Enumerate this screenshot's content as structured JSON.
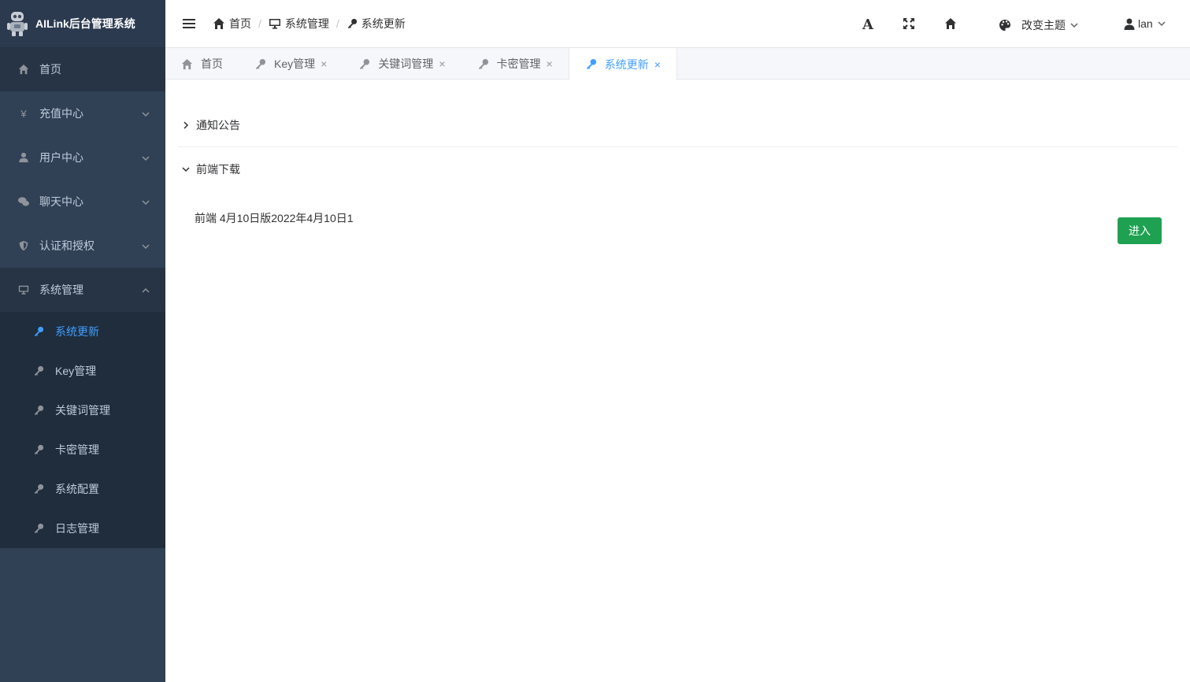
{
  "app": {
    "title": "AILink后台管理系统"
  },
  "sidebar": {
    "items": [
      {
        "label": "首页"
      },
      {
        "label": "充值中心"
      },
      {
        "label": "用户中心"
      },
      {
        "label": "聊天中心"
      },
      {
        "label": "认证和授权"
      },
      {
        "label": "系统管理"
      }
    ],
    "submenu": [
      {
        "label": "系统更新"
      },
      {
        "label": "Key管理"
      },
      {
        "label": "关键词管理"
      },
      {
        "label": "卡密管理"
      },
      {
        "label": "系统配置"
      },
      {
        "label": "日志管理"
      }
    ],
    "yen_symbol": "¥"
  },
  "breadcrumb": [
    "首页",
    "系统管理",
    "系统更新"
  ],
  "breadcrumb_sep": "/",
  "navbar": {
    "theme_label": "改变主题",
    "user": "lan",
    "font_icon_char": "A"
  },
  "tags": [
    {
      "label": "首页"
    },
    {
      "label": "Key管理",
      "close": "×"
    },
    {
      "label": "关键词管理",
      "close": "×"
    },
    {
      "label": "卡密管理",
      "close": "×"
    },
    {
      "label": "系统更新",
      "close": "×"
    }
  ],
  "main": {
    "notice_title": "通知公告",
    "download_title": "前端下载",
    "download_item": "前端 4月10日版2022年4月10日1",
    "enter_button": "进入"
  },
  "colors": {
    "sidebar_bg": "#304156",
    "active": "#409eff",
    "enter_button": "#1fa152"
  }
}
